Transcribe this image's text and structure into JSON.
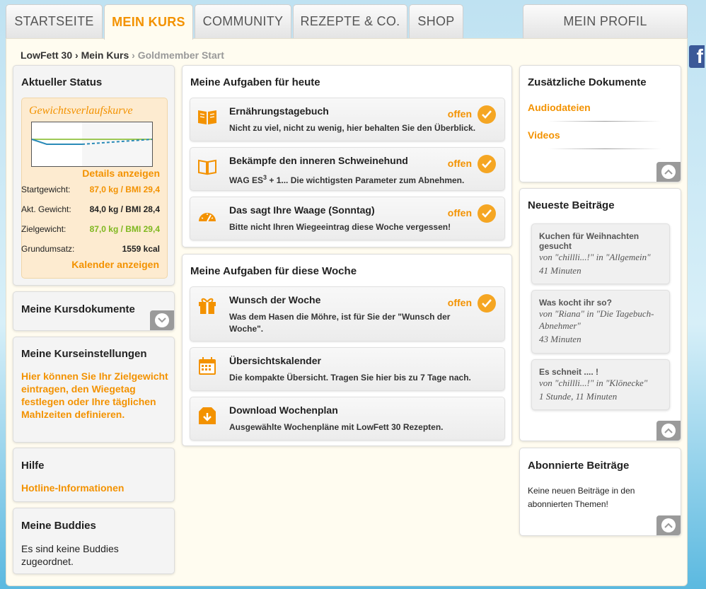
{
  "nav": {
    "tabs": [
      "STARTSEITE",
      "MEIN KURS",
      "COMMUNITY",
      "REZEPTE & CO.",
      "SHOP"
    ],
    "active_tab": "MEIN KURS",
    "profile_tab": "MEIN PROFIL",
    "facebook_letter": "f"
  },
  "breadcrumb": {
    "items": [
      "LowFett 30",
      "Mein Kurs"
    ],
    "separator": "›",
    "current": "Goldmember Start"
  },
  "status": {
    "title": "Aktueller Status",
    "chart_title": "Gewichtsverlaufskurve",
    "details_link": "Details anzeigen",
    "rows": [
      {
        "label": "Startgewicht:",
        "value": "87,0 kg / BMI 29,4",
        "color": "#f39200"
      },
      {
        "label": "Akt. Gewicht:",
        "value": "84,0 kg / BMI 28,4",
        "color": "#222222"
      },
      {
        "label": "Zielgewicht:",
        "value": "87,0 kg / BMI 29,4",
        "color": "#7fb81f"
      },
      {
        "label": "Grundumsatz:",
        "value": "1559 kcal",
        "color": "#222222"
      }
    ],
    "calendar_link": "Kalender anzeigen"
  },
  "kursdokumente": {
    "title": "Meine Kursdokumente"
  },
  "kurseinstellungen": {
    "title": "Meine Kurseinstellungen",
    "text": "Hier können Sie Ihr Zielgewicht eintragen, den Wiegetag festlegen oder Ihre täglichen Mahlzeiten definieren."
  },
  "hilfe": {
    "title": "Hilfe",
    "link": "Hotline-Informationen"
  },
  "buddies": {
    "title": "Meine Buddies",
    "text": "Es sind keine Buddies zugeordnet."
  },
  "today": {
    "title": "Meine Aufgaben für heute",
    "tasks": [
      {
        "icon": "book-icon",
        "title": "Ernährungstagebuch",
        "desc": "Nicht zu viel, nicht zu wenig, hier behalten Sie den Überblick.",
        "status": "offen"
      },
      {
        "icon": "open-book-icon",
        "title": "Bekämpfe den inneren Schweinehund",
        "desc_pre": "WAG ES",
        "desc_sup": "3",
        "desc_post": " + 1... Die wichtigsten Parameter zum Abnehmen.",
        "status": "offen"
      },
      {
        "icon": "scale-icon",
        "title": "Das sagt Ihre Waage (Sonntag)",
        "desc": "Bitte nicht Ihren Wiegeeintrag diese Woche vergessen!",
        "status": "offen"
      }
    ]
  },
  "week": {
    "title": "Meine Aufgaben für diese Woche",
    "tasks": [
      {
        "icon": "gift-icon",
        "title": "Wunsch der Woche",
        "desc": "Was dem Hasen die Möhre, ist für Sie der \"Wunsch der Woche\".",
        "status": "offen"
      },
      {
        "icon": "calendar-icon",
        "title": "Übersichtskalender",
        "desc": "Die kompakte Übersicht. Tragen Sie hier bis zu 7 Tage nach."
      },
      {
        "icon": "download-box-icon",
        "title": "Download Wochenplan",
        "desc": "Ausgewählte Wochenpläne mit LowFett 30 Rezepten."
      }
    ]
  },
  "docs": {
    "title": "Zusätzliche Dokumente",
    "links": [
      "Audiodateien",
      "Videos"
    ]
  },
  "posts": {
    "title": "Neueste Beiträge",
    "items": [
      {
        "title": "Kuchen für Weihnachten gesucht",
        "meta": "von \"chillli...!\" in \"Allgemein\"",
        "age": "41 Minuten"
      },
      {
        "title": "Was kocht ihr so?",
        "meta": "von \"Riana\" in \"Die Tagebuch-Abnehmer\"",
        "age": "43 Minuten"
      },
      {
        "title": "Es schneit .... !",
        "meta": "von \"chillli...!\" in \"Klönecke\"",
        "age": "1 Stunde, 11 Minuten"
      }
    ]
  },
  "subscribed": {
    "title": "Abonnierte Beiträge",
    "text": "Keine neuen Beiträge in den abonnierten Themen!"
  },
  "colors": {
    "accent": "#f39200",
    "green": "#7fb81f",
    "chart_line": "#2a8bb8"
  }
}
